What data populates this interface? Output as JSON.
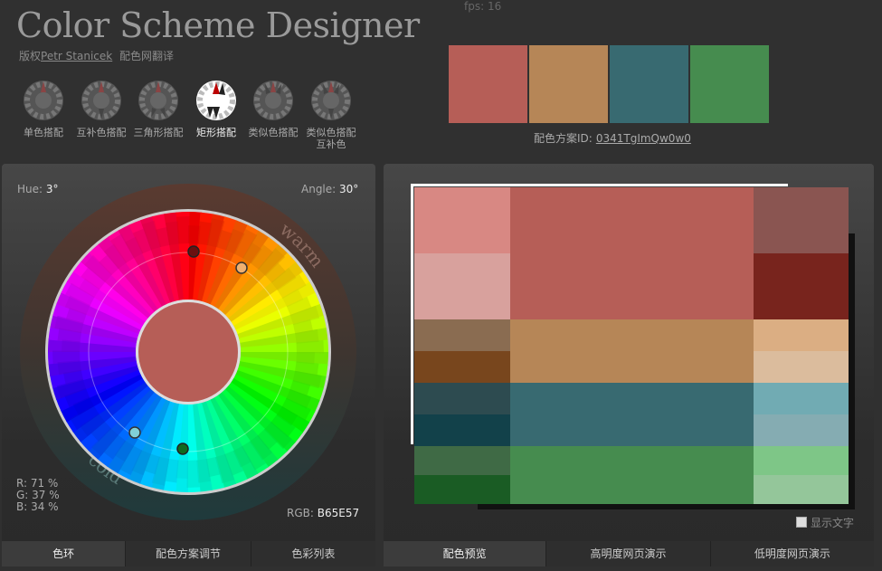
{
  "app": {
    "title": "Color Scheme Designer",
    "credit_prefix": "版权",
    "credit_author": "Petr Stanicek",
    "credit_translation": "配色网翻译",
    "fps": "fps: 16"
  },
  "modes": [
    {
      "label": "单色搭配",
      "icon": "mono-wheel-icon",
      "active": false
    },
    {
      "label": "互补色搭配",
      "icon": "complement-wheel-icon",
      "active": false
    },
    {
      "label": "三角形搭配",
      "icon": "triad-wheel-icon",
      "active": false
    },
    {
      "label": "矩形搭配",
      "icon": "tetrad-wheel-icon",
      "active": true
    },
    {
      "label": "类似色搭配",
      "icon": "analogic-wheel-icon",
      "active": false
    },
    {
      "label": "类似色搭配互补色",
      "icon": "accented-analogic-wheel-icon",
      "active": false
    }
  ],
  "scheme": {
    "colors": [
      "#B65E57",
      "#B68657",
      "#386A71",
      "#468C4F"
    ],
    "id_label": "配色方案ID:",
    "id_value": "0341TgImQw0w0"
  },
  "wheel": {
    "hue_label": "Hue:",
    "hue_value": "3°",
    "angle_label": "Angle:",
    "angle_value": "30°",
    "warm_label": "warm",
    "cold_label": "cold",
    "r_text": "R: 71 %",
    "g_text": "G: 37 %",
    "b_text": "B: 34 %",
    "rgb_label": "RGB:",
    "rgb_value": "B65E57",
    "center_color": "#B65E57"
  },
  "left_tabs": [
    {
      "label": "色环",
      "active": true
    },
    {
      "label": "配色方案调节",
      "active": false
    },
    {
      "label": "色彩列表",
      "active": false
    }
  ],
  "right_tabs": [
    {
      "label": "配色预览",
      "active": true
    },
    {
      "label": "高明度网页演示",
      "active": false
    },
    {
      "label": "低明度网页演示",
      "active": false
    }
  ],
  "preview": {
    "show_text_label": "显示文字",
    "rows": [
      {
        "left": [
          "#D88883",
          "#D8A19D"
        ],
        "main": "#B65E57",
        "right": [
          "#8A5551",
          "#78241D"
        ]
      },
      {
        "left": [
          "#8A6C51",
          "#78461D"
        ],
        "main": "#B68657",
        "right": [
          "#DBAE83",
          "#DBBC9D"
        ]
      },
      {
        "left": [
          "#2D4B50",
          "#12414A"
        ],
        "main": "#386A71",
        "right": [
          "#71ABB3",
          "#85ACB2"
        ]
      },
      {
        "left": [
          "#3F6A45",
          "#1A5C24"
        ],
        "main": "#468C4F",
        "right": [
          "#7EC687",
          "#94C69A"
        ]
      }
    ]
  }
}
